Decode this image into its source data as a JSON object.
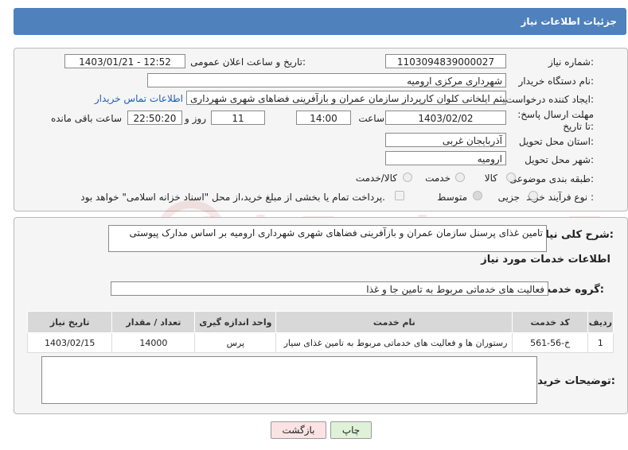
{
  "header": {
    "title": "جزئیات اطلاعات نیاز"
  },
  "fields": {
    "need_number_label": "شماره نیاز:",
    "need_number": "1103094839000027",
    "announce_label": "تاریخ و ساعت اعلان عمومی:",
    "announce_value": "1403/01/21 - 12:52",
    "buyer_org_label": "نام دستگاه خریدار:",
    "buyer_org": "شهرداری مرکزی ارومیه",
    "creator_label": "ایجاد کننده درخواست:",
    "creator": "میثم ایلخانی کلوان کارپرداز سازمان عمران و بازآفرینی فضاهای شهری شهرداری",
    "contact_link": "اطلاعات تماس خریدار",
    "deadline_label": "مهلت ارسال پاسخ: تا تاریخ:",
    "deadline_date": "1403/02/02",
    "time_label": "ساعت",
    "deadline_time": "14:00",
    "days_value": "11",
    "days_label": "روز و",
    "remaining_time": "22:50:20",
    "remaining_label": "ساعت باقی مانده",
    "province_label": "استان محل تحویل:",
    "province": "آذربایجان غربی",
    "city_label": "شهر محل تحویل:",
    "city": "ارومیه",
    "category_label": "طبقه بندی موضوعی:",
    "category_options": [
      "کالا",
      "خدمت",
      "کالا/خدمت"
    ],
    "purchase_type_label": "نوع فرآیند خرید :",
    "purchase_options": [
      "جزیی",
      "متوسط"
    ],
    "payment_note": "پرداخت تمام یا بخشی از مبلغ خرید،از محل \"اسناد خزانه اسلامی\" خواهد بود."
  },
  "description": {
    "label": "شرح کلی نیاز:",
    "text": "تامین غذای پرسنل سازمان عمران و بازآفرینی فضاهای شهری شهرداری ارومیه بر اساس مدارک پیوستی"
  },
  "services": {
    "section_title": "اطلاعات خدمات مورد نیاز",
    "group_label": "گروه خدمت:",
    "group_value": "فعالیت های خدماتی مربوط به تامین جا و غذا",
    "columns": [
      "ردیف",
      "کد خدمت",
      "نام خدمت",
      "واحد اندازه گیری",
      "تعداد / مقدار",
      "تاریخ نیاز"
    ],
    "rows": [
      [
        "1",
        "خ-56-561",
        "رستوران ها و فعالیت های خدماتی مربوط به تامین غذای سیار",
        "پرس",
        "14000",
        "1403/02/15"
      ]
    ]
  },
  "buyer_notes": {
    "label": "توضیحات خریدار:",
    "text": ""
  },
  "buttons": {
    "print": "چاپ",
    "back": "بازگشت"
  },
  "watermark": "AriaTender.neT"
}
